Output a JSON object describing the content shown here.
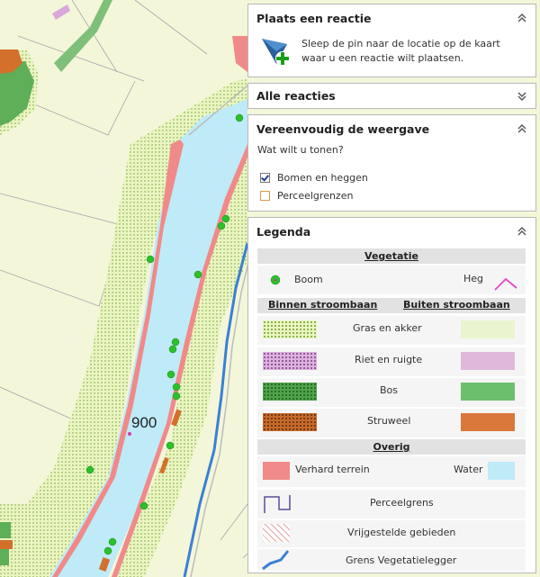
{
  "map": {
    "scale_label": "900",
    "colors": {
      "water": "#bfeaf7",
      "paved": "#f08a8a",
      "grass": "#f3f6d9",
      "forest": "#5fae58",
      "shrub": "#d2702c",
      "boundary": "#3c7fd4",
      "tree": "#2cc02c"
    }
  },
  "panels": {
    "place": {
      "title": "Plaats een reactie",
      "text_line1": "Sleep de pin naar de locatie op de kaart",
      "text_line2": "waar u een reactie wilt plaatsen.",
      "icon": "pin-add-icon"
    },
    "all": {
      "title": "Alle reacties"
    },
    "simplify": {
      "title": "Vereenvoudig de weergave",
      "question": "Wat wilt u tonen?",
      "options": [
        {
          "label": "Bomen en heggen",
          "checked": true
        },
        {
          "label": "Perceelgrenzen",
          "checked": false
        }
      ]
    },
    "legend": {
      "title": "Legenda",
      "vegetatie": "Vegetatie",
      "boom": "Boom",
      "heg": "Heg",
      "binnen": "Binnen stroombaan",
      "buiten": "Buiten stroombaan",
      "gras": "Gras en akker",
      "riet": "Riet en ruigte",
      "bos": "Bos",
      "struweel": "Struweel",
      "overig": "Overig",
      "verhard": "Verhard terrein",
      "water": "Water",
      "perceelgrens": "Perceelgrens",
      "vrijgesteld": "Vrijgestelde gebieden",
      "grens": "Grens Vegetatielegger"
    }
  }
}
